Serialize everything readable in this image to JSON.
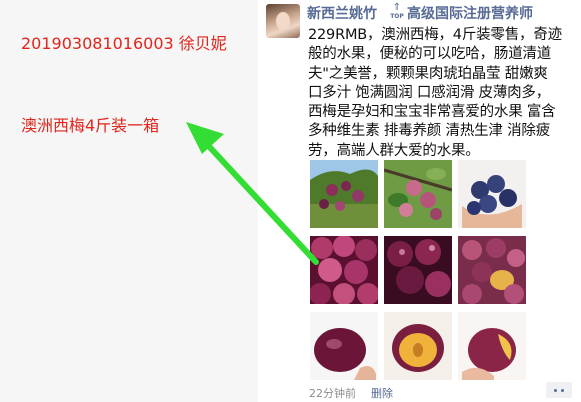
{
  "annotation": {
    "order_id": "201903081016003   徐贝妮",
    "product_note": "澳洲西梅4斤装一箱"
  },
  "post": {
    "username": "新西兰姚竹",
    "top_badge": "TOP",
    "author_title": "高级国际注册营养师",
    "body_lines": [
      "229RMB，澳洲西梅，4斤装零售，奇迹",
      "般的水果，便秘的可以吃哈，肠道清道",
      "夫\"之美誉，颗颗果肉琥珀晶莹 甜嫩爽",
      "口多汁 饱满圆润 口感润滑 皮薄肉多，",
      "西梅是孕妇和宝宝非常喜爱的水果 富含",
      "多种维生素 排毒养颜 清热生津 消除疲",
      "劳，高端人群大爱的水果。"
    ],
    "time": "22分钟前",
    "delete_label": "删除",
    "photos": [
      "plum-tree-photo",
      "plum-branch-photo",
      "plums-in-hand-photo",
      "plum-pile-photo",
      "plum-basket-photo",
      "plum-cluster-photo",
      "plum-cut-photo",
      "plum-half-photo",
      "plum-bite-photo"
    ]
  },
  "colors": {
    "annotation_red": "#e0261c",
    "arrow_green": "#33dd33",
    "link_blue": "#576b95"
  }
}
